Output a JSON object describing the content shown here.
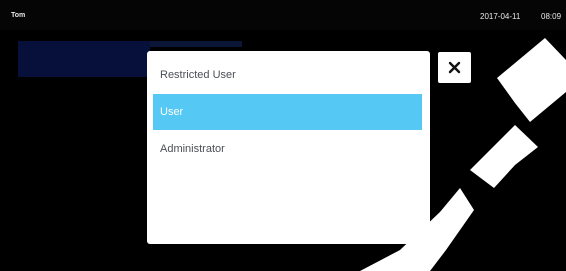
{
  "status_bar": {
    "user_name": "Tom",
    "date": "2017-04-11",
    "time": "08:09"
  },
  "dialog": {
    "options": [
      {
        "label": "Restricted User"
      },
      {
        "label": "User"
      },
      {
        "label": "Administrator"
      }
    ],
    "selected_label": "User"
  },
  "icons": {
    "close": "close-icon"
  },
  "colors": {
    "selected_background": "#55c8f3",
    "dialog_background": "#ffffff",
    "screen_background": "#000000"
  }
}
